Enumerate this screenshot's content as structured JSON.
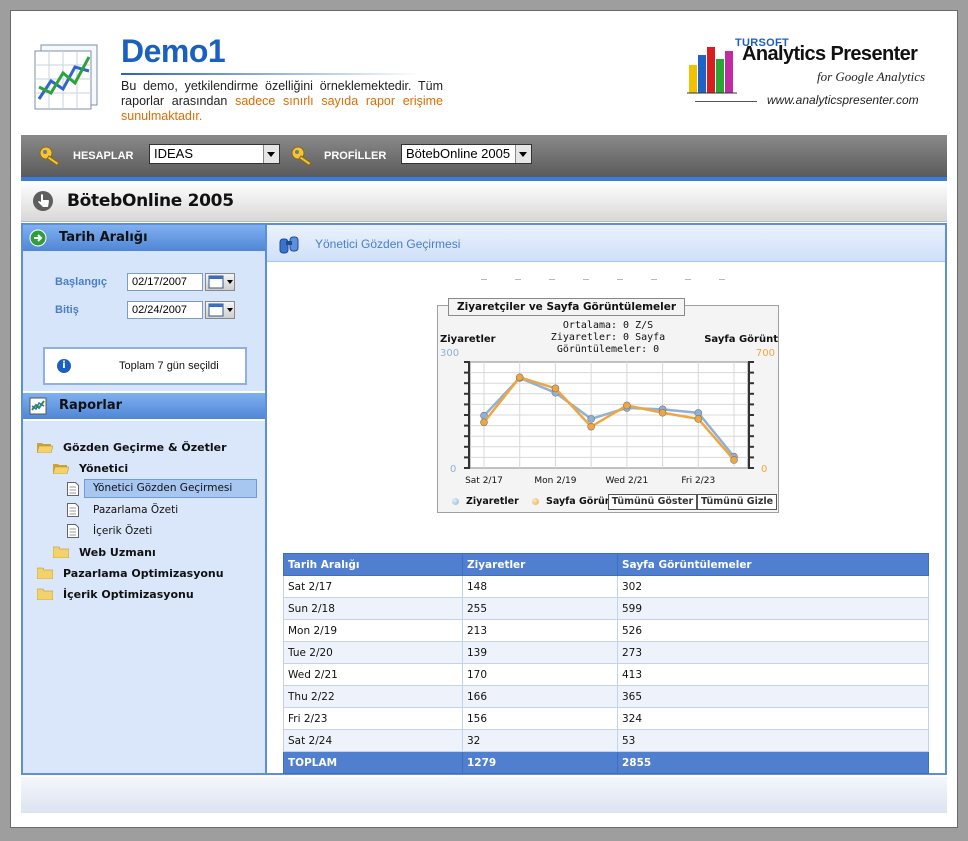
{
  "header": {
    "title": "Demo1",
    "description_plain": "Bu demo, yetkilendirme özelliğini örneklemektedir. Tüm raporlar arasından ",
    "description_highlight": "sadece sınırlı sayıda rapor erişime sunulmaktadır.",
    "brand_small": "TURSOFT",
    "brand_name": "Analytics Presenter",
    "brand_sub": "for Google Analytics",
    "brand_url": "www.analyticspresenter.com"
  },
  "toolbar": {
    "accounts_label": "HESAPLAR",
    "accounts_value": "IDEAS",
    "profiles_label": "PROFİLLER",
    "profiles_value": "BötebOnline 2005"
  },
  "profile": {
    "title": "BötebOnline 2005"
  },
  "date_range": {
    "section_title": "Tarih Aralığı",
    "start_label": "Başlangıç",
    "start_value": "02/17/2007",
    "end_label": "Bitiş",
    "end_value": "02/24/2007",
    "info": "Toplam 7 gün seçildi"
  },
  "reports": {
    "section_title": "Raporlar",
    "tree": [
      {
        "label": "Gözden Geçirme & Özetler"
      },
      {
        "label": "Yönetici"
      },
      {
        "label": "Yönetici Gözden Geçirmesi"
      },
      {
        "label": "Pazarlama Özeti"
      },
      {
        "label": "İçerik Özeti"
      },
      {
        "label": "Web Uzmanı"
      },
      {
        "label": "Pazarlama Optimizasyonu"
      },
      {
        "label": "İçerik Optimizasyonu"
      }
    ]
  },
  "main": {
    "title": "Yönetici Gözden Geçirmesi",
    "chart_avg": "Ortalama: 0 Z/S",
    "chart_avg2": "Ziyaretler: 0 Sayfa",
    "chart_avg3": "Görüntülemeler: 0",
    "show_all": "Tümünü Göster",
    "hide_all": "Tümünü Gizle"
  },
  "chart_data": {
    "type": "line",
    "title": "Ziyaretçiler ve Sayfa Görüntülemeler",
    "categories": [
      "Sat 2/17",
      "Sun 2/18",
      "Mon 2/19",
      "Tue 2/20",
      "Wed 2/21",
      "Thu 2/22",
      "Fri 2/23",
      "Sat 2/24"
    ],
    "x_tick_labels": [
      "Sat 2/17",
      "Mon 2/19",
      "Wed 2/21",
      "Fri 2/23"
    ],
    "series": [
      {
        "name": "Ziyaretler",
        "values": [
          148,
          255,
          213,
          139,
          170,
          166,
          156,
          32
        ],
        "axis": "left",
        "color": "#8fb1d6"
      },
      {
        "name": "Sayfa Görün",
        "values": [
          302,
          599,
          526,
          273,
          413,
          365,
          324,
          53
        ],
        "axis": "right",
        "color": "#f0a640"
      }
    ],
    "y_left": {
      "label": "Ziyaretler",
      "min": 0,
      "max": 300
    },
    "y_right": {
      "label": "Sayfa Görünt",
      "min": 0,
      "max": 700
    },
    "grid": true,
    "legend": "bottom-left"
  },
  "table": {
    "headers": [
      "Tarih Aralığı",
      "Ziyaretler",
      "Sayfa Görüntülemeler"
    ],
    "rows": [
      [
        "Sat 2/17",
        "148",
        "302"
      ],
      [
        "Sun 2/18",
        "255",
        "599"
      ],
      [
        "Mon 2/19",
        "213",
        "526"
      ],
      [
        "Tue 2/20",
        "139",
        "273"
      ],
      [
        "Wed 2/21",
        "170",
        "413"
      ],
      [
        "Thu 2/22",
        "166",
        "365"
      ],
      [
        "Fri 2/23",
        "156",
        "324"
      ],
      [
        "Sat 2/24",
        "32",
        "53"
      ]
    ],
    "total": [
      "TOPLAM",
      "1279",
      "2855"
    ]
  }
}
